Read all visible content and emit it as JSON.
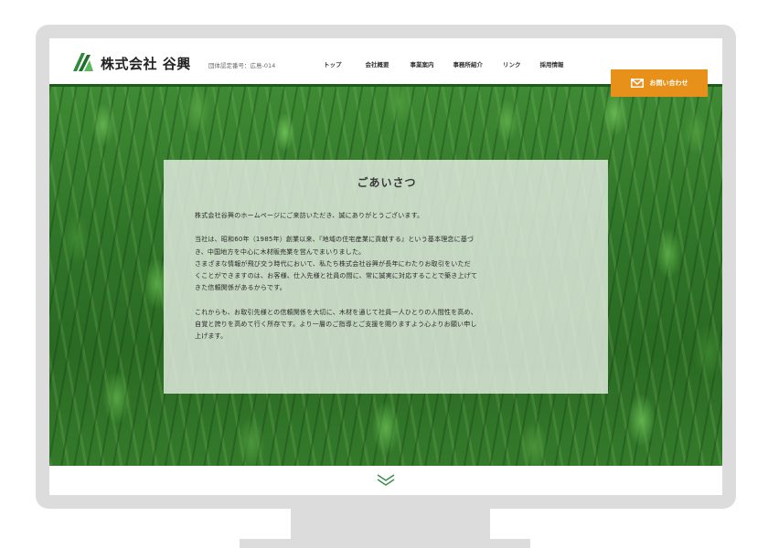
{
  "header": {
    "company_name": "株式会社 谷興",
    "cert_number": "団体認定番号：広島-014",
    "nav": [
      "トップ",
      "会社概要",
      "事業案内",
      "事務所紹介",
      "リンク",
      "採用情報"
    ],
    "contact_label": "お問い合わせ"
  },
  "greeting": {
    "title": "ごあいさつ",
    "paragraphs": [
      [
        "株式会社谷興のホームページにご来訪いただき、誠にありがとうございます。"
      ],
      [
        "当社は、昭和60年（1985年）創業以来、『地域の住宅産業に貢献する』という基本理念に基づ",
        "き、中国地方を中心に木材販売業を営んでまいりました。",
        "さまざまな情報が飛び交う時代において、私たち株式会社谷興が長年にわたりお取引をいただ",
        "くことができますのは、お客様、仕入先様と社員の間に、常に誠実に対応することで築き上げて",
        "きた信頼関係があるからです。"
      ],
      [
        "これからも、お取引先様との信頼関係を大切に、木材を通じて社員一人ひとりの人間性を高め、",
        "自覚と誇りを高めて行く所存です。より一層のご指導とご支援を賜りますよう心よりお願い申し",
        "上げます。"
      ]
    ]
  },
  "colors": {
    "accent": "#e8911a",
    "brand_green": "#2e8b3a",
    "hero_green": "#2d6d24"
  },
  "icons": {
    "logo": "leaf-logo-icon",
    "contact": "mail-icon",
    "scroll": "double-chevron-down-icon"
  }
}
